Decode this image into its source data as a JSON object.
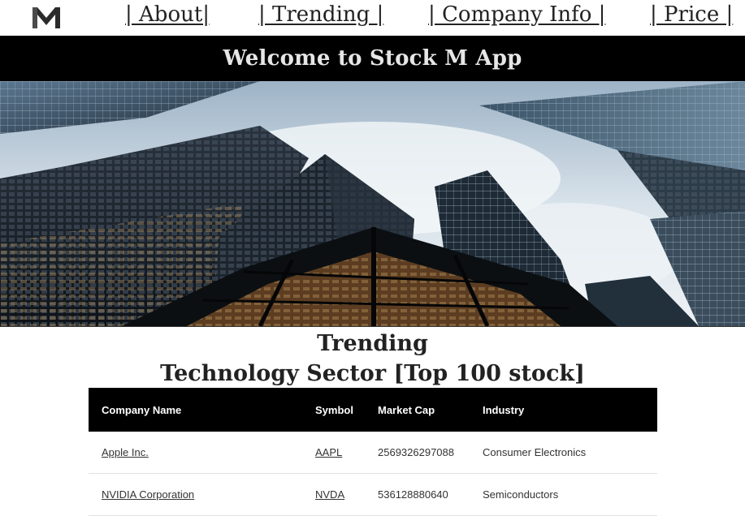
{
  "nav": {
    "logo_icon": "stock-m-logo-icon",
    "about": "| About|",
    "trending": "| Trending |",
    "company_info": "| Company Info |",
    "price": "| Price |"
  },
  "header": {
    "welcome": "Welcome to Stock M App"
  },
  "hero": {
    "image": "skyscrapers-looking-up-image"
  },
  "trending": {
    "title": "Trending",
    "sector": "Technology Sector [Top 100 stock]"
  },
  "table": {
    "headers": [
      "Company Name",
      "Symbol",
      "Market Cap",
      "Industry"
    ],
    "rows": [
      {
        "name": "Apple Inc.",
        "symbol": "AAPL",
        "market_cap": "2569326297088",
        "industry": "Consumer Electronics"
      },
      {
        "name": "NVIDIA Corporation",
        "symbol": "NVDA",
        "market_cap": "536128880640",
        "industry": "Semiconductors"
      }
    ]
  },
  "colors": {
    "header_bg": "#000000",
    "header_text": "#e6e6e6",
    "page_bg": "#ffffff"
  }
}
